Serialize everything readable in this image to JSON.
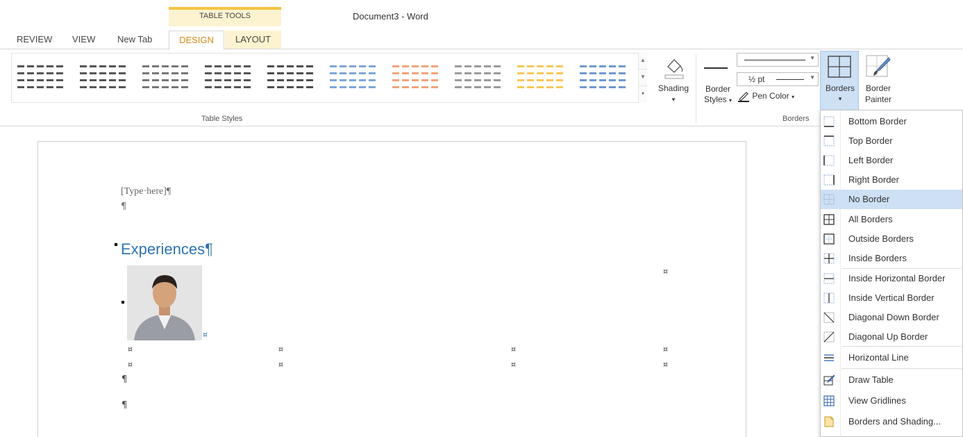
{
  "window": {
    "title": "Document3 - Word",
    "context_label": "TABLE TOOLS"
  },
  "tabs": [
    {
      "label": "REVIEW"
    },
    {
      "label": "VIEW"
    },
    {
      "label": "New Tab"
    },
    {
      "label": "DESIGN",
      "active": true
    },
    {
      "label": "LAYOUT"
    }
  ],
  "ribbon": {
    "table_styles_label": "Table Styles",
    "shading_label": "Shading",
    "border_styles_label_1": "Border",
    "border_styles_label_2": "Styles",
    "line_weight": "½ pt",
    "pen_color_label": "Pen Color",
    "borders_label": "Borders",
    "border_painter_label_1": "Border",
    "border_painter_label_2": "Painter",
    "borders_group_label": "Borders",
    "gallery_colors": [
      "#555555",
      "#555555",
      "#777777",
      "#555555",
      "#4d4d4d",
      "#7ea6d8",
      "#f0a37a",
      "#9a9a9a",
      "#f7c85a",
      "#6f98cf"
    ]
  },
  "document": {
    "placeholder": "[Type·here]¶",
    "pilcrow": "¶",
    "heading": "Experiences¶",
    "cell_mark": "¤",
    "heading_color": "#2e74b5"
  },
  "borders_menu": {
    "items": [
      {
        "label": "Bottom Border",
        "icon": "bottom-border-icon"
      },
      {
        "label": "Top Border",
        "icon": "top-border-icon"
      },
      {
        "label": "Left Border",
        "icon": "left-border-icon"
      },
      {
        "label": "Right Border",
        "icon": "right-border-icon"
      },
      {
        "label": "No Border",
        "icon": "no-border-icon",
        "highlighted": true
      },
      {
        "label": "All Borders",
        "icon": "all-borders-icon"
      },
      {
        "label": "Outside Borders",
        "icon": "outside-borders-icon"
      },
      {
        "label": "Inside Borders",
        "icon": "inside-borders-icon"
      },
      {
        "label": "Inside Horizontal Border",
        "icon": "inside-horizontal-border-icon"
      },
      {
        "label": "Inside Vertical Border",
        "icon": "inside-vertical-border-icon"
      },
      {
        "label": "Diagonal Down Border",
        "icon": "diagonal-down-border-icon"
      },
      {
        "label": "Diagonal Up Border",
        "icon": "diagonal-up-border-icon"
      },
      {
        "label": "Horizontal Line",
        "icon": "horizontal-line-icon"
      },
      {
        "label": "Draw Table",
        "icon": "draw-table-icon"
      },
      {
        "label": "View Gridlines",
        "icon": "view-gridlines-icon"
      },
      {
        "label": "Borders and Shading...",
        "icon": "borders-and-shading-icon"
      }
    ]
  }
}
